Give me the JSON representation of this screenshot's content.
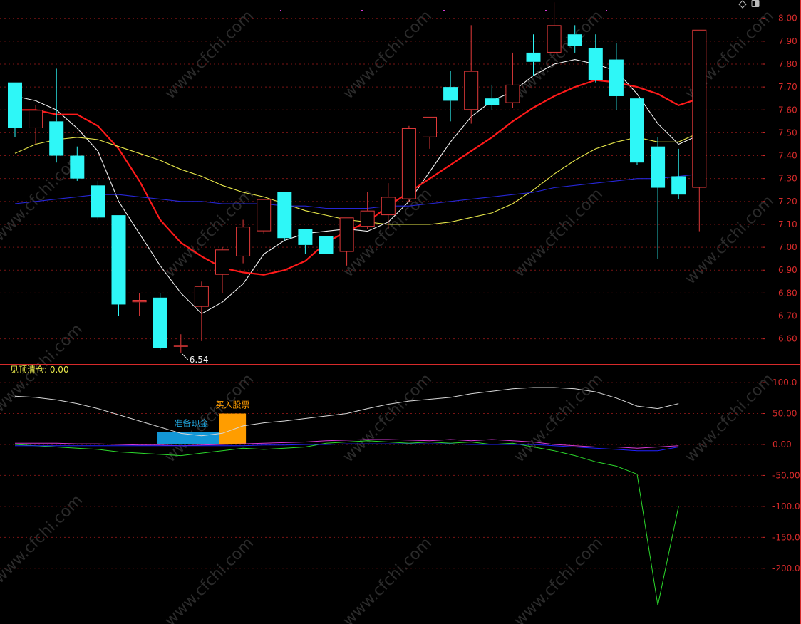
{
  "colors": {
    "background": "#000000",
    "grid": "#7a1414",
    "axis_text": "#d62a2a",
    "up": "#e23a3a",
    "down": "#2ef7f7",
    "ma5": "#f2f2f2",
    "ma10": "#ff1a1a",
    "ma20": "#e8e84a",
    "ma60": "#2626d6",
    "ind_white": "#d8d8d8",
    "ind_green": "#2cd92c",
    "ind_magenta": "#d63ad6",
    "ind_blue": "#2020ff",
    "cash_bar": "#1397d6",
    "buy_bar": "#ff9d00",
    "indicator_title": "#e8e84a",
    "cash_label": "#21a8e0",
    "buy_label": "#ff9d00"
  },
  "watermark": "www.cfchi.com",
  "chart_data": [
    {
      "type": "candlestick",
      "title": "",
      "ylim": [
        6.49,
        8.08
      ],
      "yticks": [
        "8.00",
        "7.90",
        "7.80",
        "7.70",
        "7.60",
        "7.50",
        "7.40",
        "7.30",
        "7.20",
        "7.10",
        "7.00",
        "6.90",
        "6.80",
        "6.70",
        "6.60"
      ],
      "grid": true,
      "candles": [
        {
          "open": 7.72,
          "close": 7.52,
          "high": 7.72,
          "low": 7.48
        },
        {
          "open": 7.52,
          "close": 7.6,
          "high": 7.62,
          "low": 7.45
        },
        {
          "open": 7.55,
          "close": 7.4,
          "high": 7.78,
          "low": 7.37
        },
        {
          "open": 7.4,
          "close": 7.3,
          "high": 7.44,
          "low": 7.29
        },
        {
          "open": 7.27,
          "close": 7.13,
          "high": 7.29,
          "low": 7.12
        },
        {
          "open": 7.14,
          "close": 6.75,
          "high": 7.14,
          "low": 6.7
        },
        {
          "open": 6.76,
          "close": 6.77,
          "high": 6.8,
          "low": 6.7
        },
        {
          "open": 6.78,
          "close": 6.56,
          "high": 6.8,
          "low": 6.55
        },
        {
          "open": 6.57,
          "close": 6.57,
          "high": 6.62,
          "low": 6.54
        },
        {
          "open": 6.74,
          "close": 6.83,
          "high": 6.85,
          "low": 6.59
        },
        {
          "open": 6.88,
          "close": 6.99,
          "high": 7.0,
          "low": 6.8
        },
        {
          "open": 6.96,
          "close": 7.09,
          "high": 7.12,
          "low": 6.93
        },
        {
          "open": 7.07,
          "close": 7.21,
          "high": 7.21,
          "low": 7.06
        },
        {
          "open": 7.24,
          "close": 7.04,
          "high": 7.24,
          "low": 7.03
        },
        {
          "open": 7.08,
          "close": 7.01,
          "high": 7.08,
          "low": 6.97
        },
        {
          "open": 7.05,
          "close": 6.97,
          "high": 7.07,
          "low": 6.87
        },
        {
          "open": 6.98,
          "close": 7.13,
          "high": 7.13,
          "low": 6.92
        },
        {
          "open": 7.09,
          "close": 7.16,
          "high": 7.24,
          "low": 7.08
        },
        {
          "open": 7.14,
          "close": 7.22,
          "high": 7.28,
          "low": 7.08
        },
        {
          "open": 7.21,
          "close": 7.52,
          "high": 7.53,
          "low": 7.2
        },
        {
          "open": 7.48,
          "close": 7.57,
          "high": 7.57,
          "low": 7.43
        },
        {
          "open": 7.7,
          "close": 7.64,
          "high": 7.77,
          "low": 7.55
        },
        {
          "open": 7.6,
          "close": 7.77,
          "high": 7.97,
          "low": 7.54
        },
        {
          "open": 7.65,
          "close": 7.62,
          "high": 7.71,
          "low": 7.6
        },
        {
          "open": 7.63,
          "close": 7.71,
          "high": 7.85,
          "low": 7.61
        },
        {
          "open": 7.85,
          "close": 7.81,
          "high": 7.93,
          "low": 7.75
        },
        {
          "open": 7.85,
          "close": 7.97,
          "high": 8.07,
          "low": 7.83
        },
        {
          "open": 7.93,
          "close": 7.88,
          "high": 7.97,
          "low": 7.85
        },
        {
          "open": 7.87,
          "close": 7.73,
          "high": 7.93,
          "low": 7.72
        },
        {
          "open": 7.82,
          "close": 7.66,
          "high": 7.89,
          "low": 7.6
        },
        {
          "open": 7.65,
          "close": 7.37,
          "high": 7.65,
          "low": 7.36
        },
        {
          "open": 7.44,
          "close": 7.26,
          "high": 7.48,
          "low": 6.95
        },
        {
          "open": 7.31,
          "close": 7.23,
          "high": 7.43,
          "low": 7.21
        },
        {
          "open": 7.26,
          "close": 7.95,
          "high": 7.95,
          "low": 7.07
        }
      ],
      "moving_averages": [
        {
          "name": "MA5",
          "color_key": "ma5",
          "values": [
            7.66,
            7.64,
            7.6,
            7.52,
            7.42,
            7.2,
            7.06,
            6.92,
            6.8,
            6.71,
            6.76,
            6.84,
            6.97,
            7.03,
            7.06,
            7.07,
            7.08,
            7.07,
            7.11,
            7.2,
            7.33,
            7.46,
            7.57,
            7.64,
            7.68,
            7.75,
            7.8,
            7.82,
            7.8,
            7.77,
            7.67,
            7.54,
            7.45,
            7.49
          ]
        },
        {
          "name": "MA10",
          "color_key": "ma10",
          "values": [
            7.6,
            7.6,
            7.58,
            7.58,
            7.53,
            7.43,
            7.29,
            7.12,
            7.02,
            6.96,
            6.91,
            6.89,
            6.88,
            6.9,
            6.94,
            7.02,
            7.07,
            7.11,
            7.18,
            7.24,
            7.3,
            7.36,
            7.42,
            7.48,
            7.55,
            7.61,
            7.66,
            7.7,
            7.73,
            7.72,
            7.7,
            7.67,
            7.62,
            7.65
          ]
        },
        {
          "name": "MA20",
          "color_key": "ma20",
          "values": [
            7.41,
            7.45,
            7.47,
            7.48,
            7.47,
            7.44,
            7.41,
            7.38,
            7.34,
            7.31,
            7.27,
            7.24,
            7.22,
            7.19,
            7.16,
            7.14,
            7.12,
            7.11,
            7.1,
            7.1,
            7.1,
            7.11,
            7.13,
            7.15,
            7.19,
            7.25,
            7.32,
            7.38,
            7.43,
            7.46,
            7.48,
            7.46,
            7.46,
            7.5
          ]
        },
        {
          "name": "MA60",
          "color_key": "ma60",
          "values": [
            7.19,
            7.2,
            7.21,
            7.22,
            7.23,
            7.23,
            7.22,
            7.21,
            7.2,
            7.2,
            7.19,
            7.19,
            7.19,
            7.18,
            7.18,
            7.17,
            7.17,
            7.17,
            7.18,
            7.18,
            7.19,
            7.2,
            7.21,
            7.22,
            7.23,
            7.24,
            7.26,
            7.27,
            7.28,
            7.29,
            7.3,
            7.3,
            7.31,
            7.32
          ]
        }
      ],
      "low_marker_label": "6.54"
    },
    {
      "type": "line",
      "indicator_label": "见顶清仓: 0.00",
      "ylim": [
        -290,
        130
      ],
      "yticks": [
        "100.0",
        "50.00",
        "0.00",
        "-50.00",
        "-100.0",
        "-150.0",
        "-200.0"
      ],
      "series": [
        {
          "color_key": "ind_white",
          "values": [
            78,
            76,
            72,
            66,
            58,
            48,
            38,
            28,
            18,
            14,
            18,
            30,
            35,
            38,
            42,
            46,
            50,
            58,
            65,
            70,
            73,
            76,
            82,
            86,
            90,
            92,
            92,
            90,
            85,
            75,
            62,
            58,
            66
          ]
        },
        {
          "color_key": "ind_green",
          "values": [
            0,
            -2,
            -4,
            -6,
            -8,
            -12,
            -14,
            -16,
            -18,
            -14,
            -10,
            -6,
            -8,
            -6,
            -4,
            2,
            4,
            6,
            4,
            2,
            4,
            2,
            4,
            0,
            2,
            -4,
            -10,
            -18,
            -28,
            -35,
            -48,
            -260,
            -100
          ]
        },
        {
          "color_key": "ind_magenta",
          "values": [
            2,
            2,
            2,
            1,
            1,
            0,
            -1,
            -1,
            -2,
            -1,
            0,
            1,
            2,
            3,
            4,
            6,
            7,
            8,
            8,
            7,
            6,
            8,
            6,
            8,
            6,
            4,
            0,
            -2,
            -4,
            -4,
            -6,
            -4,
            -2
          ]
        },
        {
          "color_key": "ind_blue",
          "values": [
            -2,
            -2,
            -2,
            -2,
            -2,
            -2,
            -2,
            -2,
            -2,
            -2,
            -2,
            -2,
            -1,
            -1,
            0,
            0,
            1,
            1,
            1,
            1,
            1,
            1,
            0,
            0,
            0,
            0,
            -2,
            -4,
            -6,
            -8,
            -10,
            -10,
            -4
          ]
        }
      ],
      "signals": [
        {
          "label": "准备现金",
          "color_key": "cash_bar",
          "label_color_key": "cash_label",
          "from_index": 7,
          "to_index": 10,
          "value": 20
        },
        {
          "label": "买入股票",
          "color_key": "buy_bar",
          "label_color_key": "buy_label",
          "from_index": 10,
          "to_index": 11,
          "value": 50
        }
      ]
    }
  ]
}
